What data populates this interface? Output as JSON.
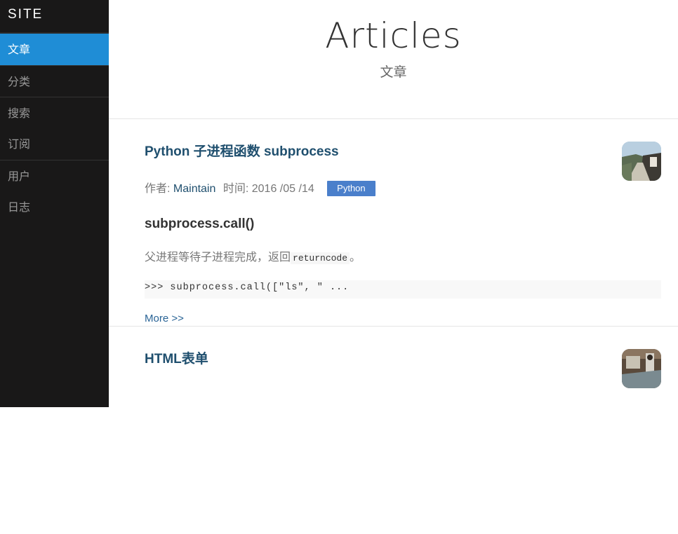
{
  "site": {
    "brand": "SITE"
  },
  "nav": {
    "items": [
      {
        "label": "文章"
      },
      {
        "label": "分类"
      },
      {
        "label": "搜索"
      },
      {
        "label": "订阅"
      },
      {
        "label": "用户"
      },
      {
        "label": "日志"
      }
    ]
  },
  "header": {
    "title": "Articles",
    "subtitle": "文章"
  },
  "posts": [
    {
      "title": "Python 子进程函数 subprocess",
      "author_prefix": "作者:",
      "author": "Maintain",
      "time_prefix": "时间:",
      "date": "2016 /05 /14",
      "tag": "Python",
      "section_heading": "subprocess.call()",
      "desc_before": "父进程等待子进程完成，返回",
      "desc_code": "returncode",
      "desc_after": "。",
      "code": ">>> subprocess.call([\"ls\", \" ...",
      "more": "More >>"
    },
    {
      "title": "HTML表单"
    }
  ],
  "colors": {
    "sidebar_bg": "#191818",
    "active_nav": "#1f8dd6",
    "title_link": "#1f4f6e",
    "tag_bg": "#4a7fcb"
  }
}
